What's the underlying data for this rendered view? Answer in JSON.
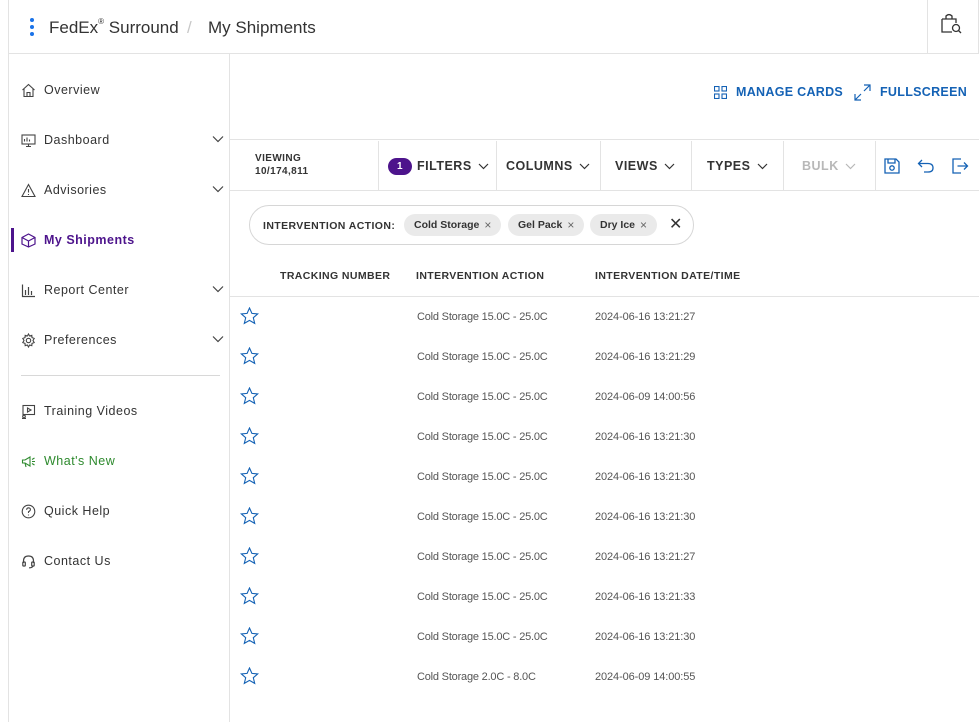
{
  "header": {
    "brand": "FedEx",
    "brand_reg": "®",
    "brand_suffix": "Surround",
    "separator": "/",
    "page": "My Shipments"
  },
  "sidebar": {
    "items": [
      {
        "label": "Overview",
        "icon": "home-icon",
        "expandable": false
      },
      {
        "label": "Dashboard",
        "icon": "dashboard-icon",
        "expandable": true
      },
      {
        "label": "Advisories",
        "icon": "warning-icon",
        "expandable": true
      },
      {
        "label": "My Shipments",
        "icon": "package-icon",
        "expandable": false,
        "active": true
      },
      {
        "label": "Report Center",
        "icon": "bar-chart-icon",
        "expandable": true
      },
      {
        "label": "Preferences",
        "icon": "gear-icon",
        "expandable": true
      }
    ],
    "secondary": [
      {
        "label": "Training Videos",
        "icon": "video-icon"
      },
      {
        "label": "What's New",
        "icon": "megaphone-icon"
      },
      {
        "label": "Quick Help",
        "icon": "help-icon"
      },
      {
        "label": "Contact Us",
        "icon": "headset-icon"
      }
    ]
  },
  "actions": {
    "manage_cards": "MANAGE CARDS",
    "fullscreen": "FULLSCREEN"
  },
  "toolbar": {
    "viewing_label": "VIEWING",
    "viewing_count": "10/174,811",
    "filter_count": "1",
    "filters": "FILTERS",
    "columns": "COLUMNS",
    "views": "VIEWS",
    "types": "TYPES",
    "bulk": "BULK"
  },
  "filter_bar": {
    "label": "INTERVENTION ACTION:",
    "chips": [
      "Cold Storage",
      "Gel Pack",
      "Dry Ice"
    ],
    "chip_remove": "×",
    "clear": "✕"
  },
  "table": {
    "columns": [
      "TRACKING NUMBER",
      "INTERVENTION ACTION",
      "INTERVENTION DATE/TIME"
    ],
    "rows": [
      {
        "tracking": "",
        "action": "Cold Storage 15.0C - 25.0C",
        "datetime": "2024-06-16 13:21:27"
      },
      {
        "tracking": "",
        "action": "Cold Storage 15.0C - 25.0C",
        "datetime": "2024-06-16 13:21:29"
      },
      {
        "tracking": "",
        "action": "Cold Storage 15.0C - 25.0C",
        "datetime": "2024-06-09 14:00:56"
      },
      {
        "tracking": "",
        "action": "Cold Storage 15.0C - 25.0C",
        "datetime": "2024-06-16 13:21:30"
      },
      {
        "tracking": "",
        "action": "Cold Storage 15.0C - 25.0C",
        "datetime": "2024-06-16 13:21:30"
      },
      {
        "tracking": "",
        "action": "Cold Storage 15.0C - 25.0C",
        "datetime": "2024-06-16 13:21:30"
      },
      {
        "tracking": "",
        "action": "Cold Storage 15.0C - 25.0C",
        "datetime": "2024-06-16 13:21:27"
      },
      {
        "tracking": "",
        "action": "Cold Storage 15.0C - 25.0C",
        "datetime": "2024-06-16 13:21:33"
      },
      {
        "tracking": "",
        "action": "Cold Storage 15.0C - 25.0C",
        "datetime": "2024-06-16 13:21:30"
      },
      {
        "tracking": "",
        "action": "Cold Storage 2.0C - 8.0C",
        "datetime": "2024-06-09 14:00:55"
      }
    ]
  },
  "colors": {
    "accent_purple": "#4d148c",
    "link_blue": "#1462b5",
    "whats_new_green": "#2e8a2e"
  }
}
